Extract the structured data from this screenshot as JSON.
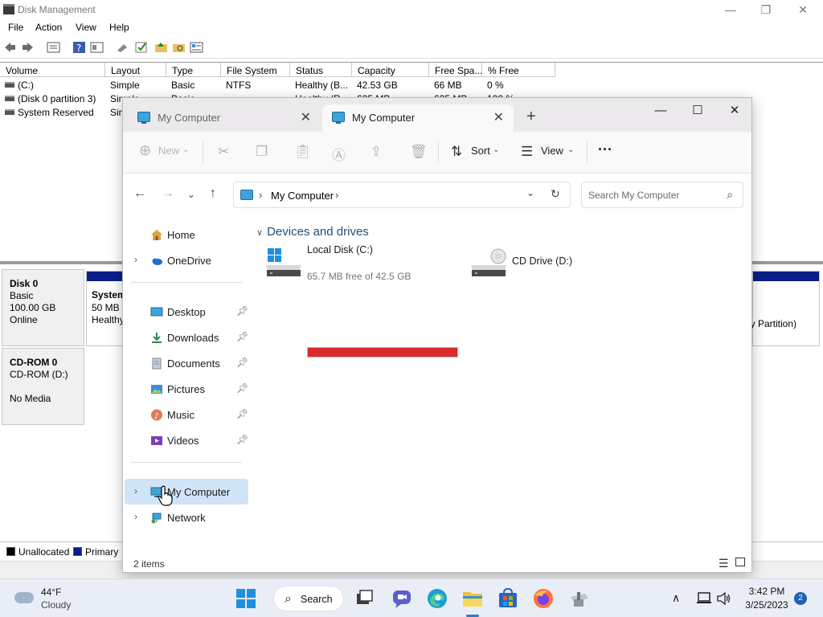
{
  "disk_mgmt": {
    "title": "Disk Management",
    "window_controls": {
      "minimize": "—",
      "maximize": "❐",
      "close": "✕"
    },
    "menu": [
      "File",
      "Action",
      "View",
      "Help"
    ],
    "columns": [
      "Volume",
      "Layout",
      "Type",
      "File System",
      "Status",
      "Capacity",
      "Free Spa...",
      "% Free"
    ],
    "rows": [
      {
        "volume": "(C:)",
        "layout": "Simple",
        "type": "Basic",
        "fs": "NTFS",
        "status": "Healthy (B...",
        "capacity": "42.53 GB",
        "free": "66 MB",
        "pct": "0 %"
      },
      {
        "volume": "(Disk 0 partition 3)",
        "layout": "Simple",
        "type": "Basic",
        "fs": "",
        "status": "Healthy (R...",
        "capacity": "625 MB",
        "free": "625 MB",
        "pct": "100 %"
      },
      {
        "volume": "System Reserved",
        "layout": "Simple",
        "type": "",
        "fs": "",
        "status": "",
        "capacity": "",
        "free": "",
        "pct": ""
      }
    ],
    "disks": [
      {
        "name": "Disk 0",
        "type": "Basic",
        "size": "100.00 GB",
        "state": "Online"
      },
      {
        "name": "CD-ROM 0",
        "type": "CD-ROM (D:)",
        "size": "",
        "state": "No Media"
      }
    ],
    "partitions": {
      "system": {
        "name": "System",
        "size": "50 MB",
        "status": "Healthy"
      },
      "right": {
        "status": "y Partition)"
      }
    },
    "legend": [
      {
        "label": "Unallocated",
        "color": "#000000"
      },
      {
        "label": "Primary",
        "color": "#0a1e88"
      }
    ]
  },
  "explorer": {
    "tabs": [
      {
        "label": "My Computer",
        "active": false
      },
      {
        "label": "My Computer",
        "active": true
      }
    ],
    "new_tab": "+",
    "window_controls": {
      "minimize": "—",
      "maximize": "☐",
      "close": "✕"
    },
    "commands": {
      "new": "New",
      "sort": "Sort",
      "view": "View",
      "more": "···"
    },
    "address": {
      "location": "My Computer"
    },
    "search": {
      "placeholder": "Search My Computer"
    },
    "nav": {
      "home": "Home",
      "onedrive": "OneDrive",
      "quick": [
        {
          "label": "Desktop",
          "icon": "desktop-icon"
        },
        {
          "label": "Downloads",
          "icon": "download-icon"
        },
        {
          "label": "Documents",
          "icon": "document-icon"
        },
        {
          "label": "Pictures",
          "icon": "picture-icon"
        },
        {
          "label": "Music",
          "icon": "music-icon"
        },
        {
          "label": "Videos",
          "icon": "video-icon"
        }
      ],
      "my_computer": "My Computer",
      "network": "Network"
    },
    "section_title": "Devices and drives",
    "drives": [
      {
        "label": "Local Disk (C:)",
        "sub": "65.7 MB free of 42.5 GB",
        "used_fraction": 0.998
      },
      {
        "label": "CD Drive (D:)",
        "sub": ""
      }
    ],
    "status": "2 items"
  },
  "taskbar": {
    "weather": {
      "temp": "44°F",
      "desc": "Cloudy"
    },
    "search_label": "Search",
    "time": "3:42 PM",
    "date": "3/25/2023",
    "notifications": "2"
  },
  "colors": {
    "accent": "#3478c9",
    "capacity_full": "#d92b2b",
    "primary_partition": "#0a1e88"
  }
}
